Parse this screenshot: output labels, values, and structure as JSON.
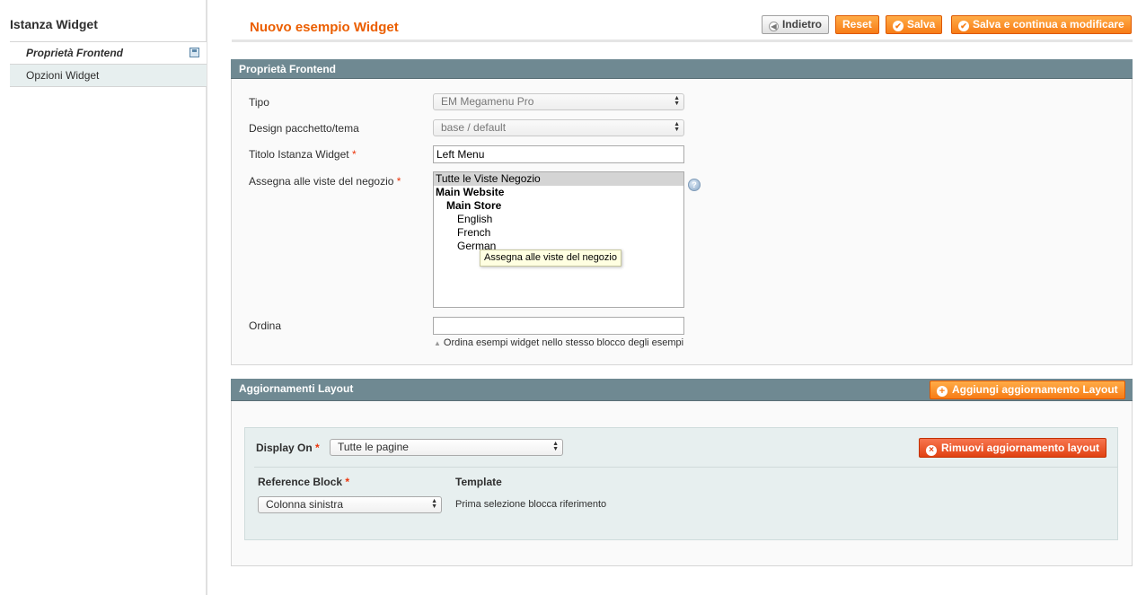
{
  "sidebar": {
    "title": "Istanza Widget",
    "tabs": [
      {
        "label": "Proprietà Frontend"
      },
      {
        "label": "Opzioni Widget"
      }
    ]
  },
  "header": {
    "title": "Nuovo esempio Widget",
    "buttons": {
      "back": "Indietro",
      "reset": "Reset",
      "save": "Salva",
      "save_continue": "Salva e continua a modificare"
    }
  },
  "frontend": {
    "section_title": "Proprietà Frontend",
    "type_label": "Tipo",
    "type_value": "EM Megamenu Pro",
    "design_label": "Design pacchetto/tema",
    "design_value": "base / default",
    "title_label": "Titolo Istanza Widget",
    "title_value": "Left Menu",
    "stores_label": "Assegna alle viste del negozio",
    "stores_options": [
      "Tutte le Viste Negozio",
      "Main Website",
      "Main Store",
      "English",
      "French",
      "German"
    ],
    "tooltip": "Assegna alle viste del negozio",
    "sort_label": "Ordina",
    "sort_value": "",
    "sort_note": "Ordina esempi widget nello stesso blocco degli esempi",
    "required_mark": "*"
  },
  "layout": {
    "section_title": "Aggiornamenti Layout",
    "add_button": "Aggiungi aggiornamento Layout",
    "display_on_label": "Display On",
    "display_on_value": "Tutte le pagine",
    "remove_button": "Rimuovi aggiornamento layout",
    "reference_block_label": "Reference Block",
    "reference_block_value": "Colonna sinistra",
    "template_label": "Template",
    "template_value": "Prima selezione blocca riferimento"
  },
  "colors": {
    "accent": "#eb5e00",
    "section_header": "#6f8992",
    "button_orange": "#f77c16",
    "remove_red": "#e14212"
  }
}
